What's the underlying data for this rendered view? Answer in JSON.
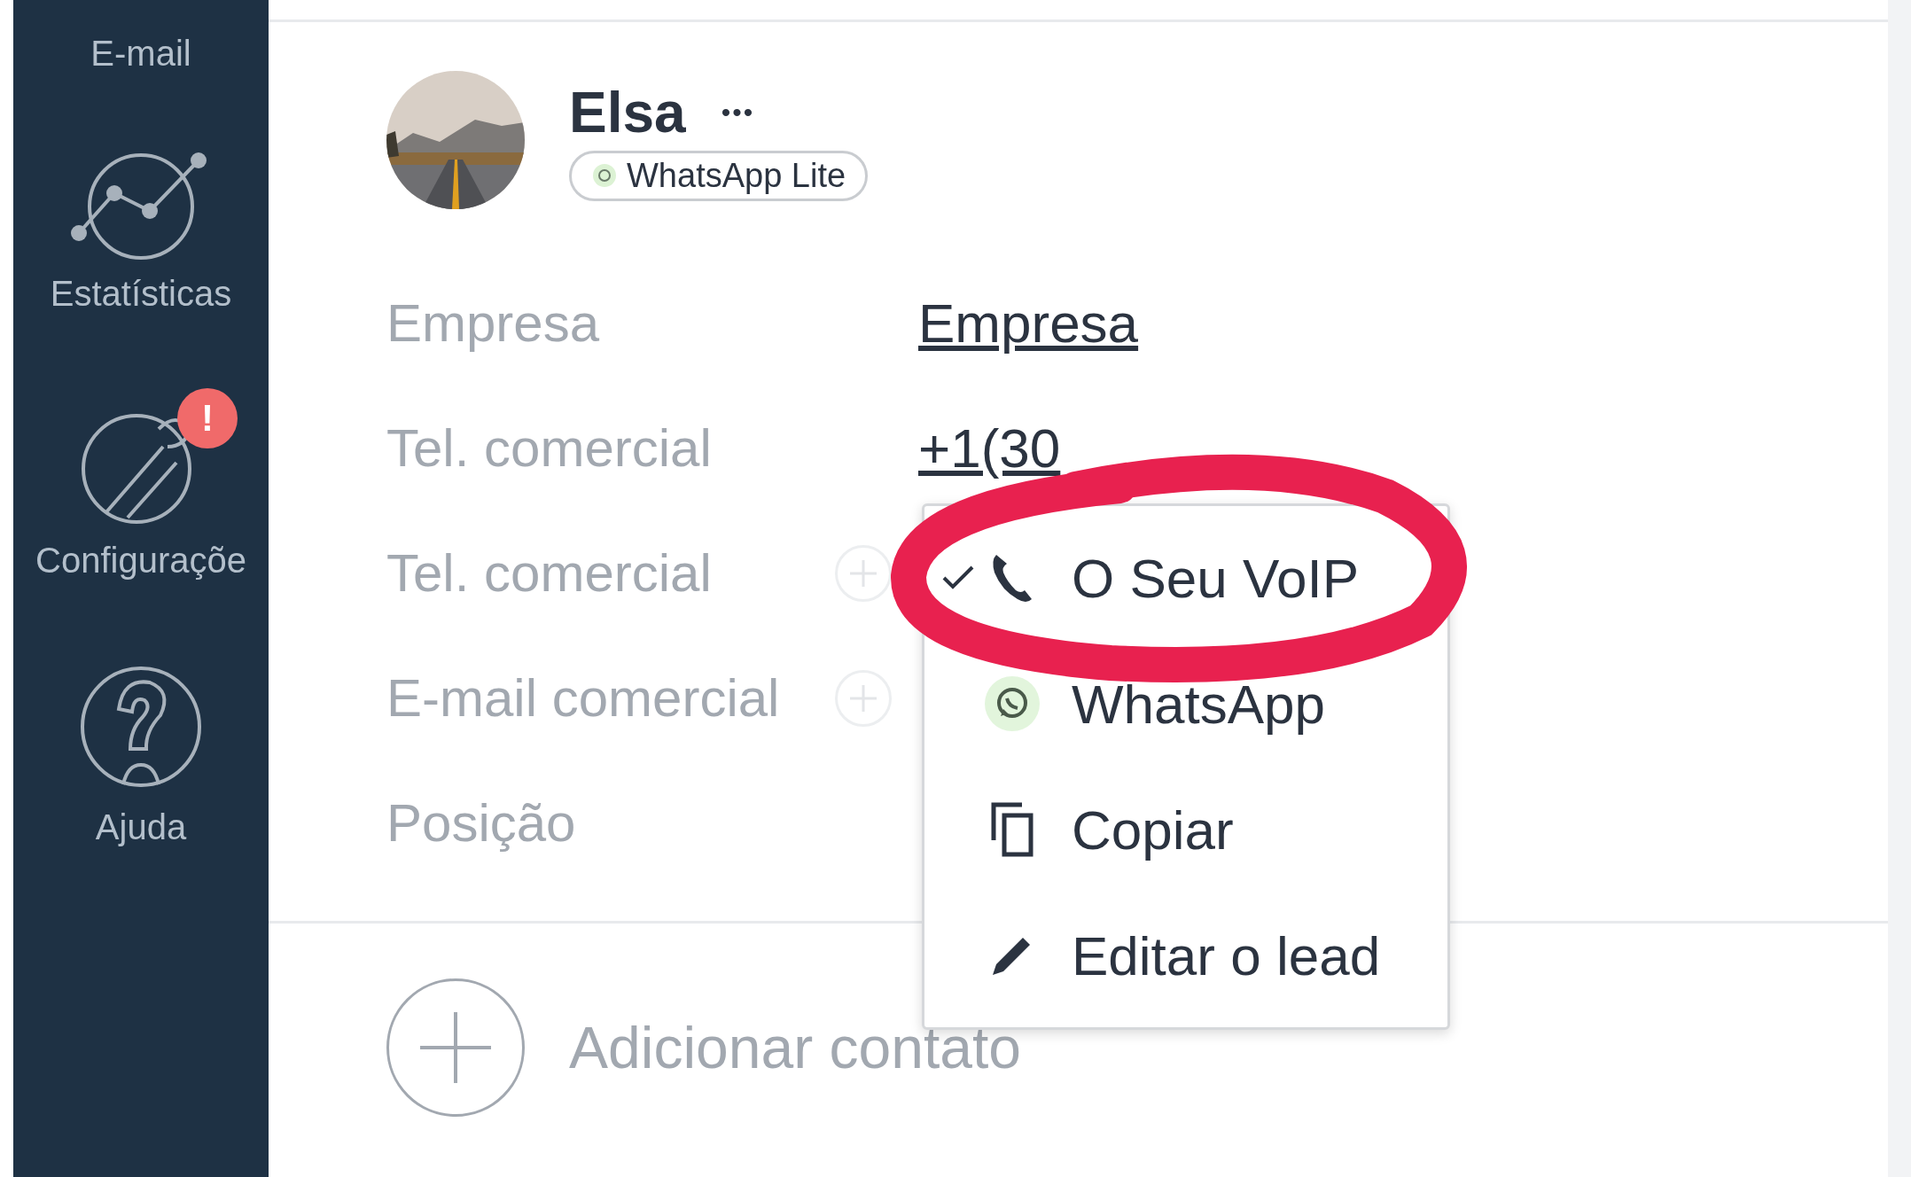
{
  "sidebar": {
    "items": [
      {
        "kind": "email",
        "label": "E-mail"
      },
      {
        "kind": "stats",
        "label": "Estatísticas"
      },
      {
        "kind": "settings",
        "label": "Configuraçõe",
        "badge": "!"
      },
      {
        "kind": "help",
        "label": "Ajuda"
      }
    ]
  },
  "contact": {
    "name": "Elsa",
    "more": "•••",
    "source": "WhatsApp Lite"
  },
  "fields": [
    {
      "label": "Empresa",
      "value": "Empresa",
      "add": false
    },
    {
      "label": "Tel. comercial",
      "value": "+1(30",
      "add": false
    },
    {
      "label": "Tel. comercial",
      "add": true
    },
    {
      "label": "E-mail comercial",
      "add": true
    },
    {
      "label": "Posição",
      "add": false
    }
  ],
  "menu": {
    "items": [
      {
        "kind": "phone",
        "label": "O Seu VoIP",
        "checked": true
      },
      {
        "kind": "whatsapp",
        "label": "WhatsApp",
        "checked": false
      },
      {
        "kind": "copy",
        "label": "Copiar",
        "checked": false
      },
      {
        "kind": "edit",
        "label": "Editar o lead",
        "checked": false
      }
    ]
  },
  "add_contact": {
    "label": "Adicionar contato"
  },
  "annotation": {
    "kind": "ellipse",
    "color": "#e8214f"
  }
}
